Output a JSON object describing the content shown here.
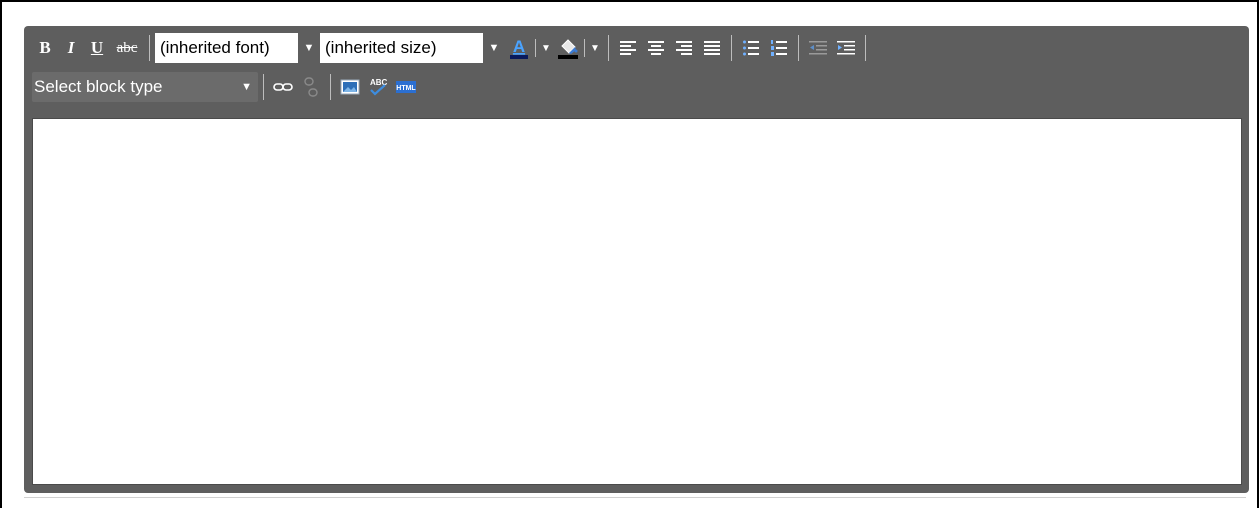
{
  "toolbar": {
    "bold_label": "B",
    "italic_label": "I",
    "underline_label": "U",
    "strike_label": "abc",
    "font_select_value": "(inherited font)",
    "size_select_value": "(inherited size)",
    "block_type_value": "Select block type",
    "icons": {
      "text_color": "text-color-icon",
      "highlight": "highlight-color-icon",
      "align_left": "align-left-icon",
      "align_center": "align-center-icon",
      "align_right": "align-right-icon",
      "align_justify": "align-justify-icon",
      "bullet_list": "bullet-list-icon",
      "numbered_list": "numbered-list-icon",
      "outdent": "outdent-icon",
      "indent": "indent-icon",
      "link": "link-icon",
      "unlink": "unlink-icon",
      "image": "image-icon",
      "spellcheck": "spellcheck-icon",
      "html": "html-source-icon"
    },
    "spellcheck_text": "ABC",
    "html_text": "HTML"
  },
  "colors": {
    "toolbar_bg": "#5e5e5e",
    "text_color_swatch": "#1a5fb4",
    "highlight_swatch": "#000000",
    "content_bg": "#ffffff"
  },
  "content": {
    "text": ""
  }
}
